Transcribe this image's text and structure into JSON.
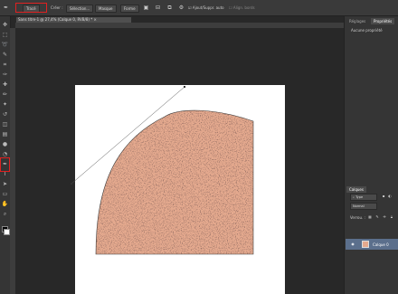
{
  "options_bar": {
    "trace_label": "Tracé",
    "make_label": "Créer :",
    "selection_label": "Sélection...",
    "mask_label": "Masque",
    "shape_label": "Forme",
    "auto_add_delete_label": "Ajout/Suppr. auto",
    "align_edges_label": "Align. bords"
  },
  "document": {
    "tab_title": "Sans titre-1 @ 27,4% (Calque 0, RVB/8) *",
    "close_symbol": "×"
  },
  "panels": {
    "top_tabs": [
      "Réglages",
      "Propriétés"
    ],
    "properties_text": "Aucune propriété",
    "layers_tab": "Calques",
    "layer_kind": "Type",
    "blend_mode": "Normal",
    "lock_label": "Verrou. :",
    "layer_name": "Calque 0"
  },
  "tools": [
    "move-tool-icon",
    "marquee-tool-icon",
    "lasso-tool-icon",
    "quick-select-tool-icon",
    "crop-tool-icon",
    "eyedropper-tool-icon",
    "healing-brush-tool-icon",
    "brush-tool-icon",
    "clone-stamp-tool-icon",
    "history-brush-tool-icon",
    "eraser-tool-icon",
    "gradient-tool-icon",
    "blur-tool-icon",
    "dodge-tool-icon",
    "pen-tool-icon",
    "type-tool-icon",
    "path-select-tool-icon",
    "shape-tool-icon",
    "hand-tool-icon",
    "zoom-tool-icon"
  ],
  "colors": {
    "highlight": "#e02020",
    "texture_base": "#e4a98e"
  }
}
